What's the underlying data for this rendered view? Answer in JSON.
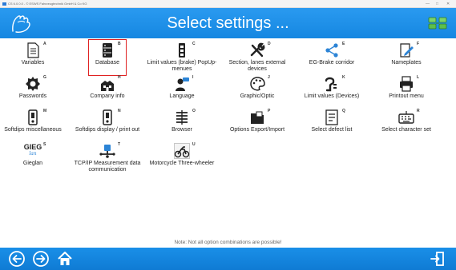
{
  "window": {
    "title": "CS 6.0.0.0 - © ESWS Fahrzeugtechnik GmbH & Co KG",
    "controls": [
      "minimize",
      "maximize",
      "close"
    ]
  },
  "header": {
    "title": "Select settings ...",
    "logo_icon": "hand-logo-icon",
    "settings_icon": "settings-toggle-icon"
  },
  "tiles": [
    {
      "label": "Variables",
      "key": "A",
      "icon": "document-icon"
    },
    {
      "label": "Database",
      "key": "B",
      "icon": "database-icon",
      "selected": true
    },
    {
      "label": "Limit values (brake) PopUp-menues",
      "key": "C",
      "icon": "limit-values-icon"
    },
    {
      "label": "Section, lanes external devices",
      "key": "D",
      "icon": "tools-icon"
    },
    {
      "label": "EG-Brake corridor",
      "key": "E",
      "icon": "share-icon"
    },
    {
      "label": "Nameplates",
      "key": "F",
      "icon": "edit-document-icon"
    },
    {
      "label": "Passwords",
      "key": "G",
      "icon": "badge-icon"
    },
    {
      "label": "Company info",
      "key": "H",
      "icon": "company-icon"
    },
    {
      "label": "Language",
      "key": "I",
      "icon": "speech-person-icon"
    },
    {
      "label": "Graphic/Optic",
      "key": "J",
      "icon": "palette-icon"
    },
    {
      "label": "Limit values (Devices)",
      "key": "K",
      "icon": "plug-icon"
    },
    {
      "label": "Printout menu",
      "key": "L",
      "icon": "printer-icon"
    },
    {
      "label": "Softdips miscellaneous",
      "key": "M",
      "icon": "switch-device-icon"
    },
    {
      "label": "Softdips display / print out",
      "key": "N",
      "icon": "switch-device-icon"
    },
    {
      "label": "Browser",
      "key": "O",
      "icon": "list-icon"
    },
    {
      "label": "Options Export/Import",
      "key": "P",
      "icon": "folder-icon"
    },
    {
      "label": "Select defect list",
      "key": "Q",
      "icon": "defect-list-icon"
    },
    {
      "label": "Select character set",
      "key": "R",
      "icon": "keyboard-icon"
    },
    {
      "label": "Gieglan",
      "key": "S",
      "icon": "gieglan-logo",
      "logo_text": "GIEG",
      "logo_sub": "lan"
    },
    {
      "label": "TCP/IP Measurement data communication",
      "key": "T",
      "icon": "network-icon"
    },
    {
      "label": "Motorcycle Three-wheeler",
      "key": "U",
      "icon": "motorcycle-icon"
    }
  ],
  "note": "Note: Not all option combinations are possible!",
  "footer": {
    "back_icon": "arrow-left-icon",
    "forward_icon": "arrow-right-icon",
    "home_icon": "home-icon",
    "exit_icon": "exit-icon"
  },
  "colors": {
    "header": "#1587e1",
    "footer": "#0f7bd4",
    "selection": "#e02222",
    "icon": "#222222"
  }
}
